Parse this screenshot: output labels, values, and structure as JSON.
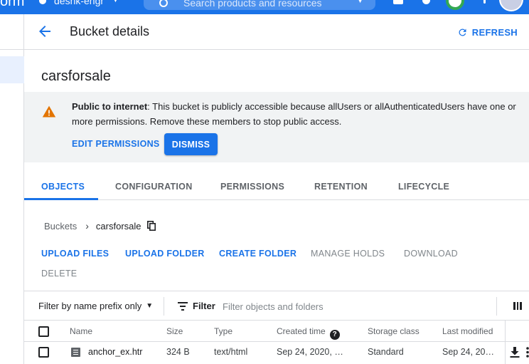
{
  "topbar": {
    "brand": "orm",
    "project": "deshk-engr",
    "search_placeholder": "Search products and resources"
  },
  "header": {
    "title": "Bucket details",
    "refresh_label": "REFRESH"
  },
  "bucket": {
    "name": "carsforsale"
  },
  "banner": {
    "title": "Public to internet",
    "message": ": This bucket is publicly accessible because allUsers or allAuthenticatedUsers have one or more permissions. Remove these members to stop public access.",
    "edit_label": "EDIT PERMISSIONS",
    "dismiss_label": "DISMISS"
  },
  "tabs": [
    {
      "label": "OBJECTS",
      "active": true
    },
    {
      "label": "CONFIGURATION"
    },
    {
      "label": "PERMISSIONS"
    },
    {
      "label": "RETENTION"
    },
    {
      "label": "LIFECYCLE"
    }
  ],
  "breadcrumb": {
    "root": "Buckets",
    "current": "carsforsale"
  },
  "actions": {
    "upload_files": "UPLOAD FILES",
    "upload_folder": "UPLOAD FOLDER",
    "create_folder": "CREATE FOLDER",
    "manage_holds": "MANAGE HOLDS",
    "download": "DOWNLOAD",
    "delete": "DELETE"
  },
  "filter": {
    "prefix_label": "Filter by name prefix only",
    "label": "Filter",
    "placeholder": "Filter objects and folders"
  },
  "table": {
    "columns": [
      "Name",
      "Size",
      "Type",
      "Created time",
      "Storage class",
      "Last modified"
    ],
    "rows": [
      {
        "name": "anchor_ex.htr",
        "size": "324 B",
        "type": "text/html",
        "created": "Sep 24, 2020, …",
        "storage_class": "Standard",
        "modified": "Sep 24, 20…"
      }
    ]
  },
  "colors": {
    "primary": "#1a73e8",
    "warning": "#e37400",
    "banner_bg": "#f1f3f4"
  }
}
